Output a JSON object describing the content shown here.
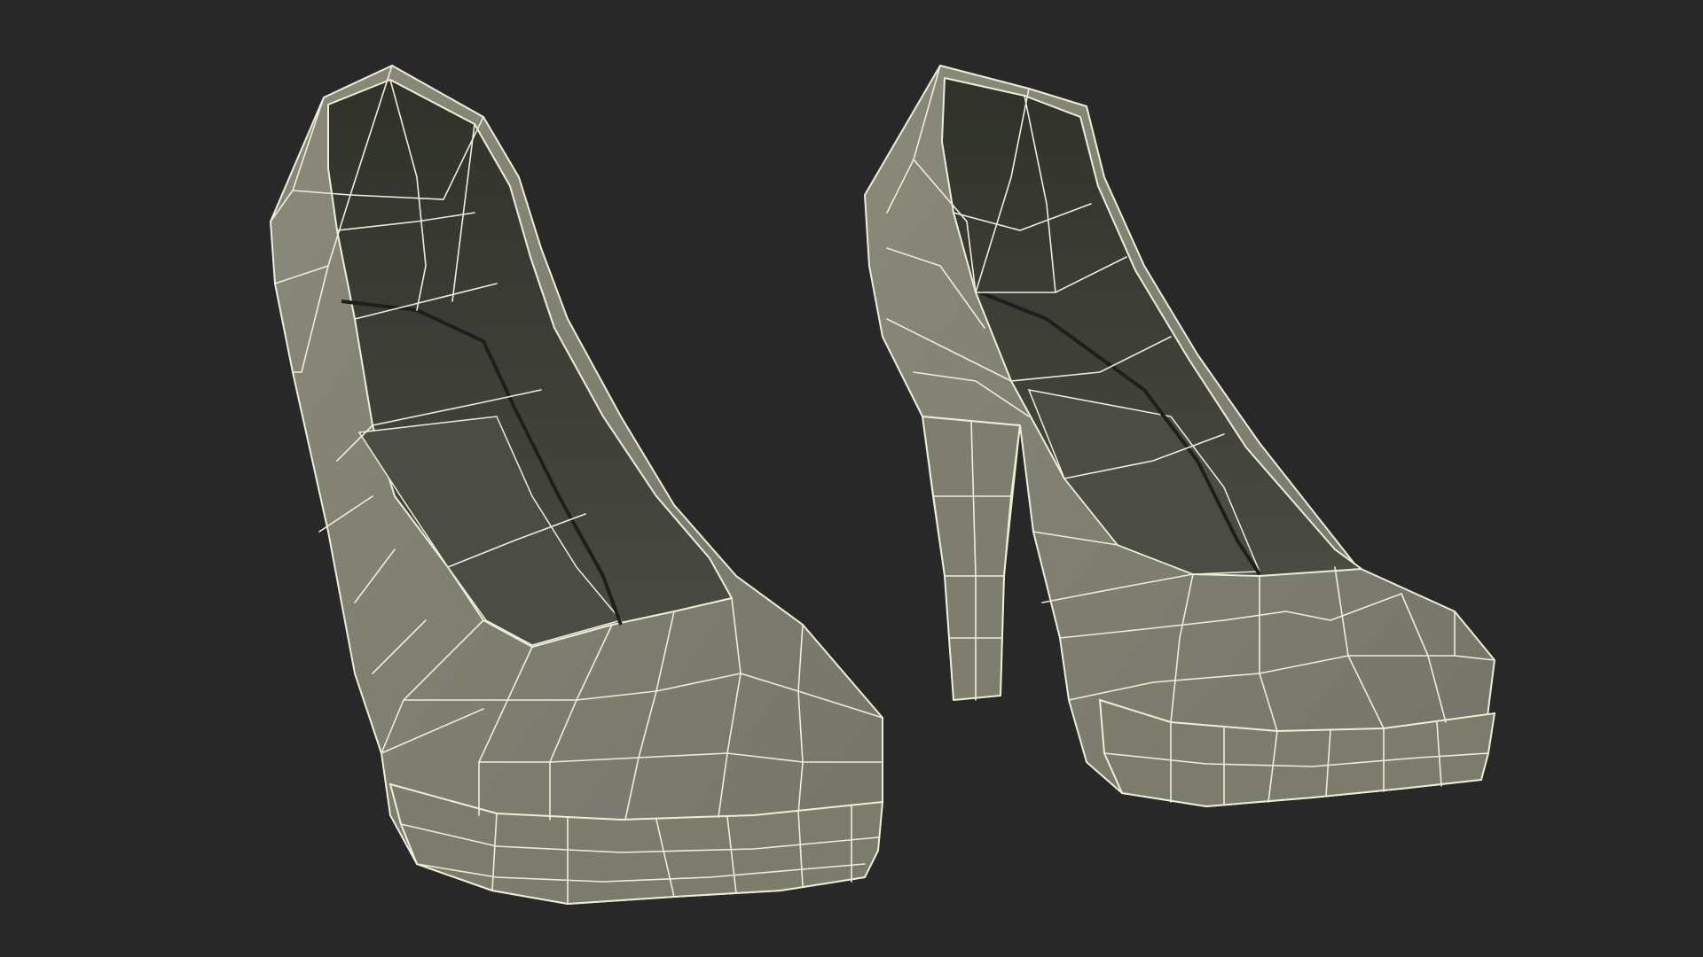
{
  "scene": {
    "background": "#282828",
    "colors": {
      "shell": "#80806f",
      "shell_light": "#8c8c7b",
      "shell_dark": "#6e6e60",
      "interior": "#3c3e36",
      "interior_deep": "#2f312b",
      "insole": "#4b4d45",
      "wire": "#eeeed8"
    },
    "objects": [
      {
        "name": "left-shoe",
        "view": "front-three-quarter"
      },
      {
        "name": "right-shoe",
        "view": "side-three-quarter"
      }
    ]
  }
}
